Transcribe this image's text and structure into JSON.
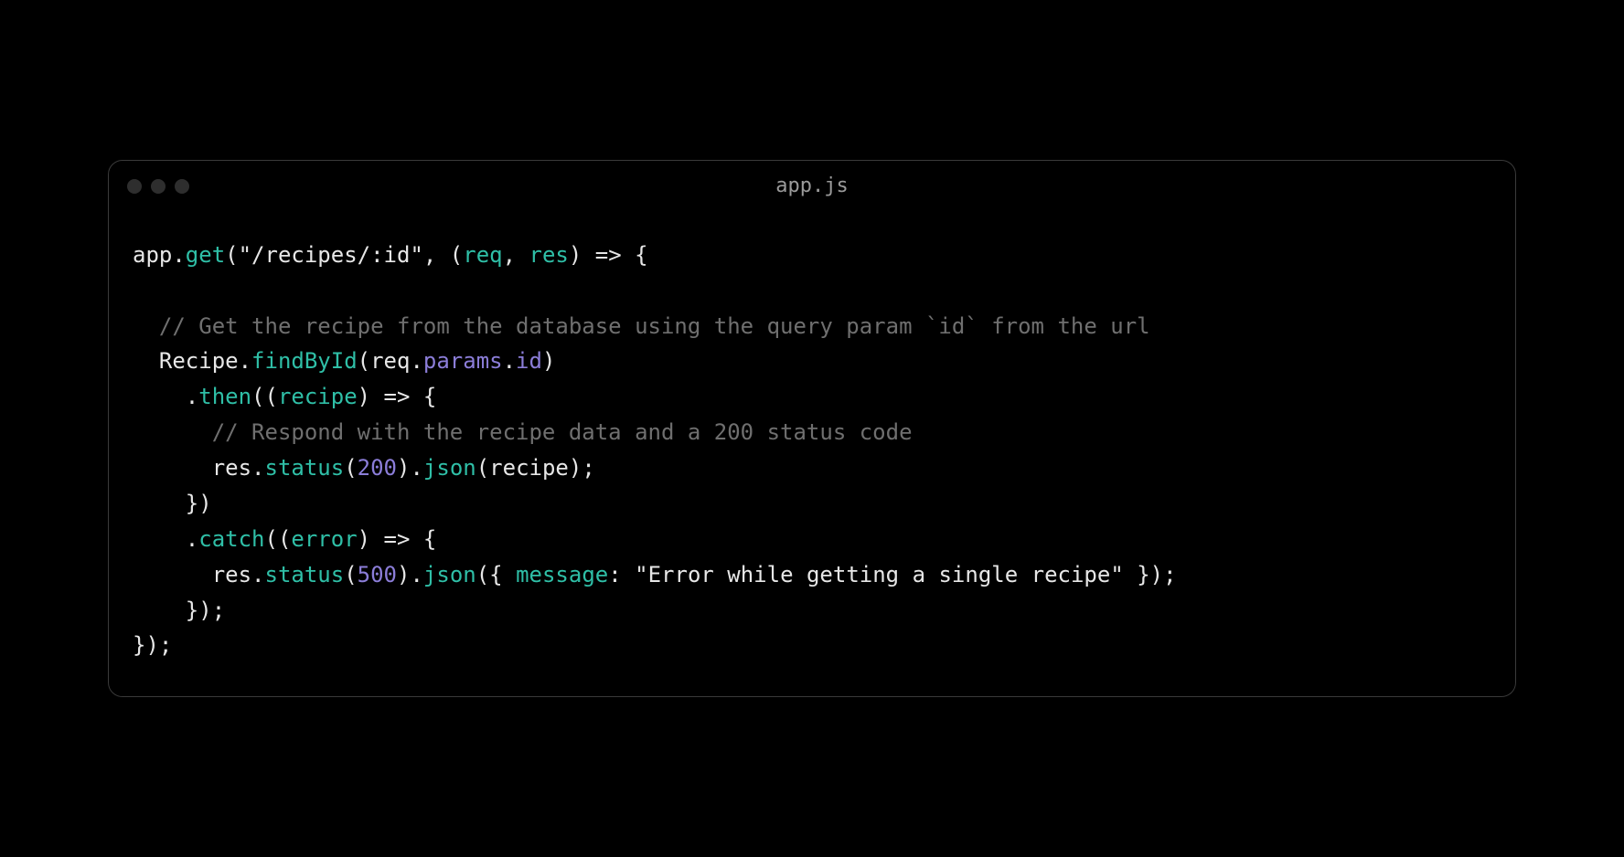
{
  "window": {
    "title": "app.js"
  },
  "code": {
    "tokens": [
      [
        {
          "t": "app.",
          "c": "tok-default"
        },
        {
          "t": "get",
          "c": "tok-method"
        },
        {
          "t": "(",
          "c": "tok-default"
        },
        {
          "t": "\"/recipes/:id\"",
          "c": "tok-string"
        },
        {
          "t": ", (",
          "c": "tok-default"
        },
        {
          "t": "req",
          "c": "tok-param"
        },
        {
          "t": ", ",
          "c": "tok-default"
        },
        {
          "t": "res",
          "c": "tok-param"
        },
        {
          "t": ") => {",
          "c": "tok-default"
        }
      ],
      [],
      [
        {
          "t": "  ",
          "c": "tok-default"
        },
        {
          "t": "// Get the recipe from the database using the query param `id` from the url",
          "c": "tok-comment"
        }
      ],
      [
        {
          "t": "  Recipe.",
          "c": "tok-default"
        },
        {
          "t": "findById",
          "c": "tok-method"
        },
        {
          "t": "(req.",
          "c": "tok-default"
        },
        {
          "t": "params",
          "c": "tok-prop"
        },
        {
          "t": ".",
          "c": "tok-default"
        },
        {
          "t": "id",
          "c": "tok-prop"
        },
        {
          "t": ")",
          "c": "tok-default"
        }
      ],
      [
        {
          "t": "    .",
          "c": "tok-default"
        },
        {
          "t": "then",
          "c": "tok-method"
        },
        {
          "t": "((",
          "c": "tok-default"
        },
        {
          "t": "recipe",
          "c": "tok-param"
        },
        {
          "t": ") => {",
          "c": "tok-default"
        }
      ],
      [
        {
          "t": "      ",
          "c": "tok-default"
        },
        {
          "t": "// Respond with the recipe data and a 200 status code",
          "c": "tok-comment"
        }
      ],
      [
        {
          "t": "      res.",
          "c": "tok-default"
        },
        {
          "t": "status",
          "c": "tok-method"
        },
        {
          "t": "(",
          "c": "tok-default"
        },
        {
          "t": "200",
          "c": "tok-number"
        },
        {
          "t": ").",
          "c": "tok-default"
        },
        {
          "t": "json",
          "c": "tok-method"
        },
        {
          "t": "(recipe);",
          "c": "tok-default"
        }
      ],
      [
        {
          "t": "    })",
          "c": "tok-default"
        }
      ],
      [
        {
          "t": "    .",
          "c": "tok-default"
        },
        {
          "t": "catch",
          "c": "tok-method"
        },
        {
          "t": "((",
          "c": "tok-default"
        },
        {
          "t": "error",
          "c": "tok-param"
        },
        {
          "t": ") => {",
          "c": "tok-default"
        }
      ],
      [
        {
          "t": "      res.",
          "c": "tok-default"
        },
        {
          "t": "status",
          "c": "tok-method"
        },
        {
          "t": "(",
          "c": "tok-default"
        },
        {
          "t": "500",
          "c": "tok-number"
        },
        {
          "t": ").",
          "c": "tok-default"
        },
        {
          "t": "json",
          "c": "tok-method"
        },
        {
          "t": "({ ",
          "c": "tok-default"
        },
        {
          "t": "message",
          "c": "tok-key"
        },
        {
          "t": ": ",
          "c": "tok-default"
        },
        {
          "t": "\"Error while getting a single recipe\"",
          "c": "tok-string"
        },
        {
          "t": " });",
          "c": "tok-default"
        }
      ],
      [
        {
          "t": "    });",
          "c": "tok-default"
        }
      ],
      [
        {
          "t": "});",
          "c": "tok-default"
        }
      ]
    ]
  }
}
